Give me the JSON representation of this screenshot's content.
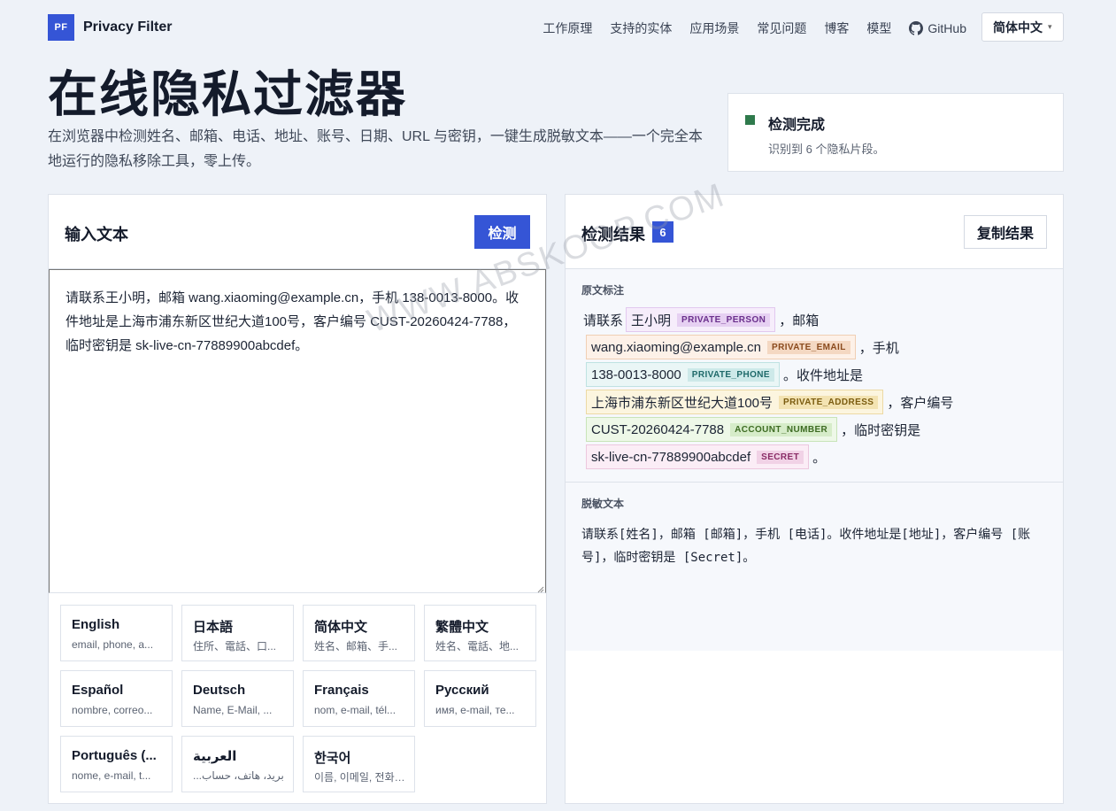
{
  "header": {
    "logo_mark": "PF",
    "logo_text": "Privacy Filter",
    "nav": [
      "工作原理",
      "支持的实体",
      "应用场景",
      "常见问题",
      "博客",
      "模型"
    ],
    "github_label": "GitHub",
    "language_select": "简体中文"
  },
  "hero": {
    "title": "在线隐私过滤器",
    "description": "在浏览器中检测姓名、邮箱、电话、地址、账号、日期、URL 与密钥，一键生成脱敏文本——一个完全本地运行的隐私移除工具，零上传。"
  },
  "status": {
    "title": "检测完成",
    "subtitle": "识别到 6 个隐私片段。",
    "color": "#2f7a4c"
  },
  "input_panel": {
    "title": "输入文本",
    "detect_button": "检测",
    "text": "请联系王小明，邮箱 wang.xiaoming@example.cn，手机 138-0013-8000。收件地址是上海市浦东新区世纪大道100号，客户编号 CUST-20260424-7788，临时密钥是 sk-live-cn-77889900abcdef。"
  },
  "languages": [
    {
      "name": "English",
      "desc": "email, phone, a..."
    },
    {
      "name": "日本語",
      "desc": "住所、電話、口..."
    },
    {
      "name": "简体中文",
      "desc": "姓名、邮箱、手..."
    },
    {
      "name": "繁體中文",
      "desc": "姓名、電話、地..."
    },
    {
      "name": "Español",
      "desc": "nombre, correo..."
    },
    {
      "name": "Deutsch",
      "desc": "Name, E-Mail, ..."
    },
    {
      "name": "Français",
      "desc": "nom, e-mail, tél..."
    },
    {
      "name": "Русский",
      "desc": "имя, e-mail, те..."
    },
    {
      "name": "Português (...",
      "desc": "nome, e-mail, t..."
    },
    {
      "name": "العربية",
      "desc": "...بريد، هاتف، حساب"
    },
    {
      "name": "한국어",
      "desc": "이름, 이메일, 전화,..."
    }
  ],
  "result_panel": {
    "title": "检测结果",
    "count": "6",
    "copy_button": "复制结果",
    "annotated_label": "原文标注",
    "redacted_label": "脱敏文本",
    "lines": [
      {
        "before": "请联系",
        "chip": {
          "text": "王小明",
          "tag": "PRIVATE_PERSON",
          "kind": "person"
        },
        "after": "，邮箱"
      },
      {
        "before": "",
        "chip": {
          "text": "wang.xiaoming@example.cn",
          "tag": "PRIVATE_EMAIL",
          "kind": "email"
        },
        "after": "，手机"
      },
      {
        "before": "",
        "chip": {
          "text": "138-0013-8000",
          "tag": "PRIVATE_PHONE",
          "kind": "phone"
        },
        "after": "。收件地址是"
      },
      {
        "before": "",
        "chip": {
          "text": "上海市浦东新区世纪大道100号",
          "tag": "PRIVATE_ADDRESS",
          "kind": "address"
        },
        "after": "，客户编号"
      },
      {
        "before": "",
        "chip": {
          "text": "CUST-20260424-7788",
          "tag": "ACCOUNT_NUMBER",
          "kind": "account"
        },
        "after": "，临时密钥是"
      },
      {
        "before": "",
        "chip": {
          "text": "sk-live-cn-77889900abcdef",
          "tag": "SECRET",
          "kind": "secret"
        },
        "after": "。"
      }
    ],
    "redacted_text": "请联系[姓名]，邮箱 [邮箱]，手机 [电话]。收件地址是[地址]，客户编号 [账号]，临时密钥是 [Secret]。"
  },
  "watermark": "WWW.ABSKOOP.COM"
}
